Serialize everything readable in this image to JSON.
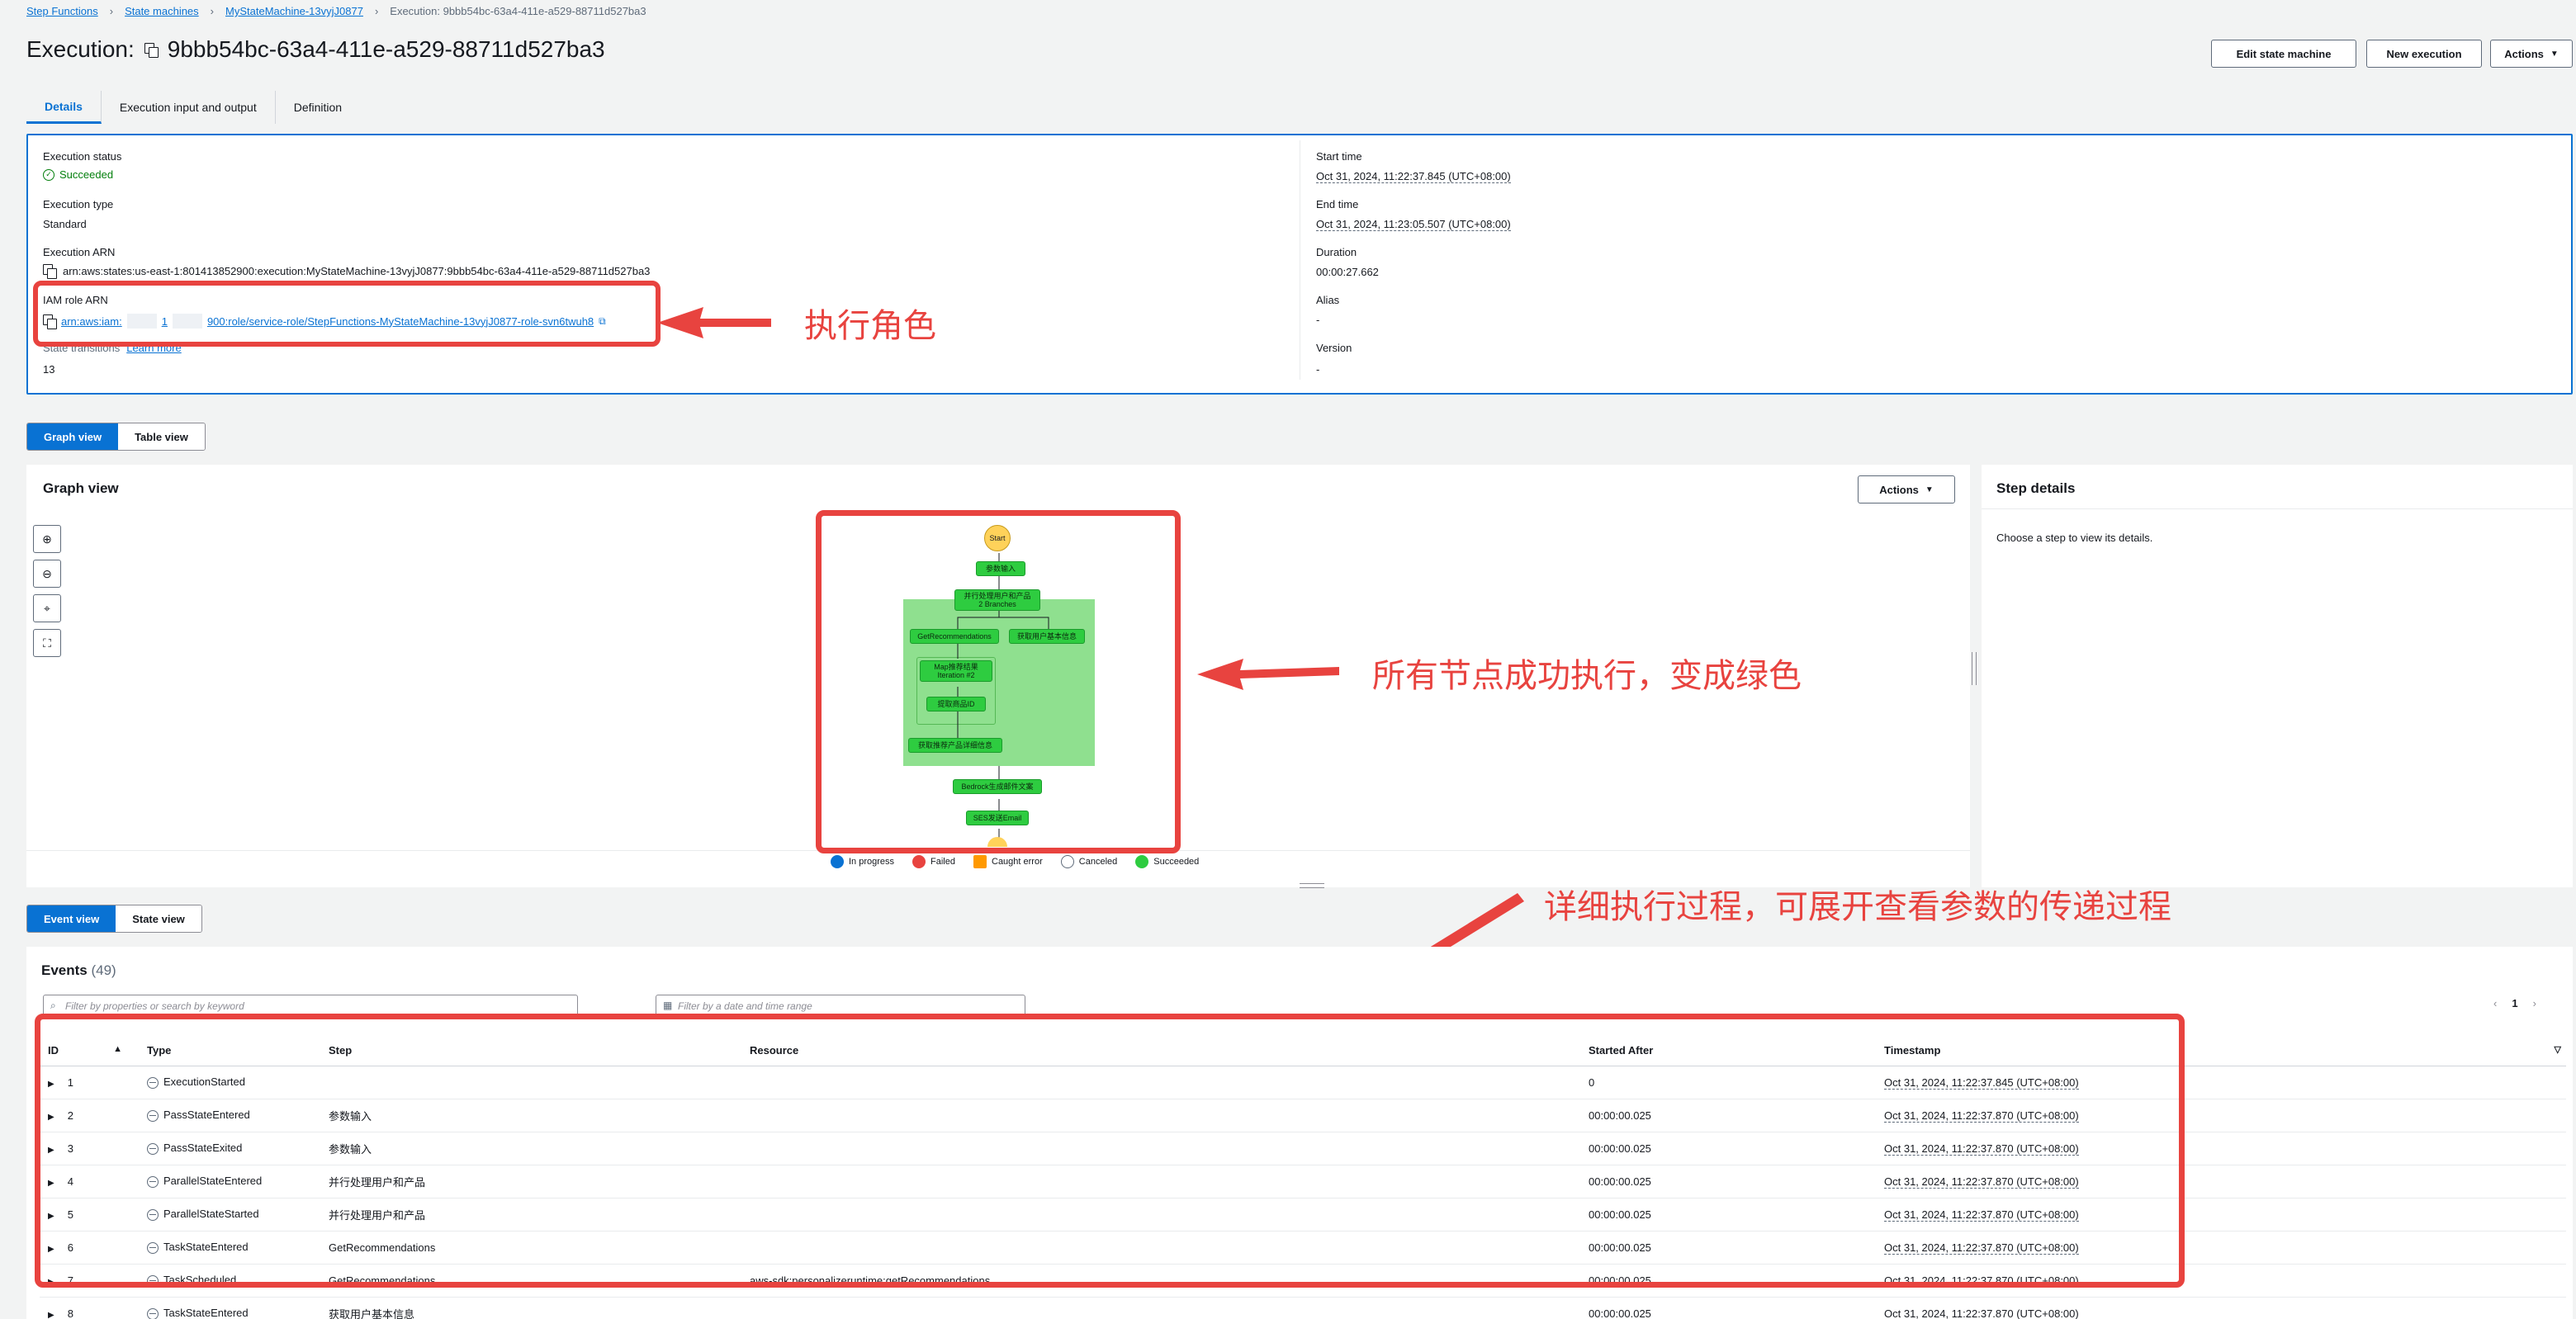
{
  "breadcrumb": [
    "Step Functions",
    "State machines",
    "MyStateMachine-13vyjJ0877",
    "Execution: 9bbb54bc-63a4-411e-a529-88711d527ba3"
  ],
  "header": {
    "title_prefix": "Execution:",
    "title_id": "9bbb54bc-63a4-411e-a529-88711d527ba3",
    "edit_button": "Edit state machine",
    "new_button": "New execution",
    "actions_button": "Actions"
  },
  "tabs": [
    "Details",
    "Execution input and output",
    "Definition"
  ],
  "details": {
    "status_label": "Execution status",
    "status_value": "Succeeded",
    "type_label": "Execution type",
    "type_value": "Standard",
    "arn_label": "Execution ARN",
    "arn_value": "arn:aws:states:us-east-1:801413852900:execution:MyStateMachine-13vyjJ0877:9bbb54bc-63a4-411e-a529-88711d527ba3",
    "role_label": "IAM role ARN",
    "role_value_start": "arn:aws:iam:",
    "role_value_mid": "1",
    "role_value_end": "900:role/service-role/StepFunctions-MyStateMachine-13vyjJ0877-role-svn6twuh8",
    "transitions_label": "State transitions",
    "transitions_learn": "Learn more",
    "transitions_value": "13",
    "start_label": "Start time",
    "start_value": "Oct 31, 2024, 11:22:37.845 (UTC+08:00)",
    "end_label": "End time",
    "end_value": "Oct 31, 2024, 11:23:05.507 (UTC+08:00)",
    "duration_label": "Duration",
    "duration_value": "00:00:27.662",
    "alias_label": "Alias",
    "alias_value": "-",
    "version_label": "Version",
    "version_value": "-"
  },
  "annotations": {
    "role": "执行角色",
    "graph": "所有节点成功执行，变成绿色",
    "events": "详细执行过程，可展开查看参数的传递过程"
  },
  "view_toggle": {
    "graph": "Graph view",
    "table": "Table view"
  },
  "graph": {
    "title": "Graph view",
    "actions": "Actions",
    "nodes": {
      "start": "Start",
      "input": "参数输入",
      "parallel": "并行处理用户和产品",
      "branches": "2 Branches",
      "getrec": "GetRecommendations",
      "userinfo": "获取用户基本信息",
      "map": "Map推荐结果",
      "iteration": "Iteration #2",
      "fetch": "提取商品ID",
      "detail": "获取推荐产品详细信息",
      "bedrock": "Bedrock生成邮件文案",
      "ses": "SES发送Email"
    },
    "legend": [
      "In progress",
      "Failed",
      "Caught error",
      "Canceled",
      "Succeeded"
    ]
  },
  "step_details": {
    "title": "Step details",
    "hint": "Choose a step to view its details."
  },
  "event_toggle": {
    "event": "Event view",
    "state": "State view"
  },
  "events": {
    "title": "Events",
    "count": "(49)",
    "filter_placeholder": "Filter by properties or search by keyword",
    "date_placeholder": "Filter by a date and time range",
    "page": "1",
    "columns": [
      "ID",
      "Type",
      "Step",
      "Resource",
      "Started After",
      "Timestamp"
    ],
    "rows": [
      {
        "id": "1",
        "type": "ExecutionStarted",
        "step": "",
        "resource": "",
        "after": "0",
        "ts": "Oct 31, 2024, 11:22:37.845 (UTC+08:00)"
      },
      {
        "id": "2",
        "type": "PassStateEntered",
        "step": "参数输入",
        "resource": "",
        "after": "00:00:00.025",
        "ts": "Oct 31, 2024, 11:22:37.870 (UTC+08:00)"
      },
      {
        "id": "3",
        "type": "PassStateExited",
        "step": "参数输入",
        "resource": "",
        "after": "00:00:00.025",
        "ts": "Oct 31, 2024, 11:22:37.870 (UTC+08:00)"
      },
      {
        "id": "4",
        "type": "ParallelStateEntered",
        "step": "并行处理用户和产品",
        "resource": "",
        "after": "00:00:00.025",
        "ts": "Oct 31, 2024, 11:22:37.870 (UTC+08:00)"
      },
      {
        "id": "5",
        "type": "ParallelStateStarted",
        "step": "并行处理用户和产品",
        "resource": "",
        "after": "00:00:00.025",
        "ts": "Oct 31, 2024, 11:22:37.870 (UTC+08:00)"
      },
      {
        "id": "6",
        "type": "TaskStateEntered",
        "step": "GetRecommendations",
        "resource": "",
        "after": "00:00:00.025",
        "ts": "Oct 31, 2024, 11:22:37.870 (UTC+08:00)"
      },
      {
        "id": "7",
        "type": "TaskScheduled",
        "step": "GetRecommendations",
        "resource": "aws-sdk:personalizeruntime:getRecommendations",
        "after": "00:00:00.025",
        "ts": "Oct 31, 2024, 11:22:37.870 (UTC+08:00)"
      },
      {
        "id": "8",
        "type": "TaskStateEntered",
        "step": "获取用户基本信息",
        "resource": "",
        "after": "00:00:00.025",
        "ts": "Oct 31, 2024, 11:22:37.870 (UTC+08:00)"
      }
    ]
  }
}
